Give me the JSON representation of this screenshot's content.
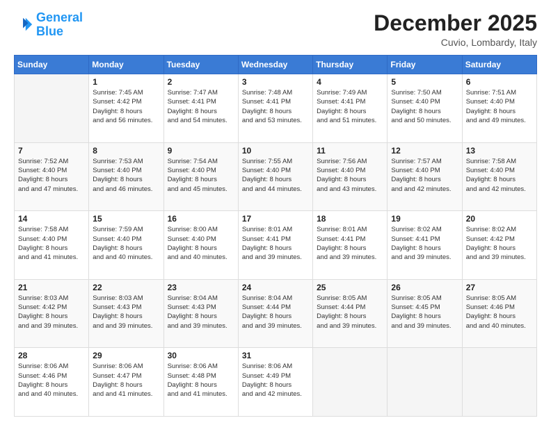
{
  "logo": {
    "line1": "General",
    "line2": "Blue"
  },
  "header": {
    "month": "December 2025",
    "location": "Cuvio, Lombardy, Italy"
  },
  "weekdays": [
    "Sunday",
    "Monday",
    "Tuesday",
    "Wednesday",
    "Thursday",
    "Friday",
    "Saturday"
  ],
  "weeks": [
    [
      {
        "day": "",
        "sunrise": "",
        "sunset": "",
        "daylight": ""
      },
      {
        "day": "1",
        "sunrise": "Sunrise: 7:45 AM",
        "sunset": "Sunset: 4:42 PM",
        "daylight": "Daylight: 8 hours and 56 minutes."
      },
      {
        "day": "2",
        "sunrise": "Sunrise: 7:47 AM",
        "sunset": "Sunset: 4:41 PM",
        "daylight": "Daylight: 8 hours and 54 minutes."
      },
      {
        "day": "3",
        "sunrise": "Sunrise: 7:48 AM",
        "sunset": "Sunset: 4:41 PM",
        "daylight": "Daylight: 8 hours and 53 minutes."
      },
      {
        "day": "4",
        "sunrise": "Sunrise: 7:49 AM",
        "sunset": "Sunset: 4:41 PM",
        "daylight": "Daylight: 8 hours and 51 minutes."
      },
      {
        "day": "5",
        "sunrise": "Sunrise: 7:50 AM",
        "sunset": "Sunset: 4:40 PM",
        "daylight": "Daylight: 8 hours and 50 minutes."
      },
      {
        "day": "6",
        "sunrise": "Sunrise: 7:51 AM",
        "sunset": "Sunset: 4:40 PM",
        "daylight": "Daylight: 8 hours and 49 minutes."
      }
    ],
    [
      {
        "day": "7",
        "sunrise": "Sunrise: 7:52 AM",
        "sunset": "Sunset: 4:40 PM",
        "daylight": "Daylight: 8 hours and 47 minutes."
      },
      {
        "day": "8",
        "sunrise": "Sunrise: 7:53 AM",
        "sunset": "Sunset: 4:40 PM",
        "daylight": "Daylight: 8 hours and 46 minutes."
      },
      {
        "day": "9",
        "sunrise": "Sunrise: 7:54 AM",
        "sunset": "Sunset: 4:40 PM",
        "daylight": "Daylight: 8 hours and 45 minutes."
      },
      {
        "day": "10",
        "sunrise": "Sunrise: 7:55 AM",
        "sunset": "Sunset: 4:40 PM",
        "daylight": "Daylight: 8 hours and 44 minutes."
      },
      {
        "day": "11",
        "sunrise": "Sunrise: 7:56 AM",
        "sunset": "Sunset: 4:40 PM",
        "daylight": "Daylight: 8 hours and 43 minutes."
      },
      {
        "day": "12",
        "sunrise": "Sunrise: 7:57 AM",
        "sunset": "Sunset: 4:40 PM",
        "daylight": "Daylight: 8 hours and 42 minutes."
      },
      {
        "day": "13",
        "sunrise": "Sunrise: 7:58 AM",
        "sunset": "Sunset: 4:40 PM",
        "daylight": "Daylight: 8 hours and 42 minutes."
      }
    ],
    [
      {
        "day": "14",
        "sunrise": "Sunrise: 7:58 AM",
        "sunset": "Sunset: 4:40 PM",
        "daylight": "Daylight: 8 hours and 41 minutes."
      },
      {
        "day": "15",
        "sunrise": "Sunrise: 7:59 AM",
        "sunset": "Sunset: 4:40 PM",
        "daylight": "Daylight: 8 hours and 40 minutes."
      },
      {
        "day": "16",
        "sunrise": "Sunrise: 8:00 AM",
        "sunset": "Sunset: 4:40 PM",
        "daylight": "Daylight: 8 hours and 40 minutes."
      },
      {
        "day": "17",
        "sunrise": "Sunrise: 8:01 AM",
        "sunset": "Sunset: 4:41 PM",
        "daylight": "Daylight: 8 hours and 39 minutes."
      },
      {
        "day": "18",
        "sunrise": "Sunrise: 8:01 AM",
        "sunset": "Sunset: 4:41 PM",
        "daylight": "Daylight: 8 hours and 39 minutes."
      },
      {
        "day": "19",
        "sunrise": "Sunrise: 8:02 AM",
        "sunset": "Sunset: 4:41 PM",
        "daylight": "Daylight: 8 hours and 39 minutes."
      },
      {
        "day": "20",
        "sunrise": "Sunrise: 8:02 AM",
        "sunset": "Sunset: 4:42 PM",
        "daylight": "Daylight: 8 hours and 39 minutes."
      }
    ],
    [
      {
        "day": "21",
        "sunrise": "Sunrise: 8:03 AM",
        "sunset": "Sunset: 4:42 PM",
        "daylight": "Daylight: 8 hours and 39 minutes."
      },
      {
        "day": "22",
        "sunrise": "Sunrise: 8:03 AM",
        "sunset": "Sunset: 4:43 PM",
        "daylight": "Daylight: 8 hours and 39 minutes."
      },
      {
        "day": "23",
        "sunrise": "Sunrise: 8:04 AM",
        "sunset": "Sunset: 4:43 PM",
        "daylight": "Daylight: 8 hours and 39 minutes."
      },
      {
        "day": "24",
        "sunrise": "Sunrise: 8:04 AM",
        "sunset": "Sunset: 4:44 PM",
        "daylight": "Daylight: 8 hours and 39 minutes."
      },
      {
        "day": "25",
        "sunrise": "Sunrise: 8:05 AM",
        "sunset": "Sunset: 4:44 PM",
        "daylight": "Daylight: 8 hours and 39 minutes."
      },
      {
        "day": "26",
        "sunrise": "Sunrise: 8:05 AM",
        "sunset": "Sunset: 4:45 PM",
        "daylight": "Daylight: 8 hours and 39 minutes."
      },
      {
        "day": "27",
        "sunrise": "Sunrise: 8:05 AM",
        "sunset": "Sunset: 4:46 PM",
        "daylight": "Daylight: 8 hours and 40 minutes."
      }
    ],
    [
      {
        "day": "28",
        "sunrise": "Sunrise: 8:06 AM",
        "sunset": "Sunset: 4:46 PM",
        "daylight": "Daylight: 8 hours and 40 minutes."
      },
      {
        "day": "29",
        "sunrise": "Sunrise: 8:06 AM",
        "sunset": "Sunset: 4:47 PM",
        "daylight": "Daylight: 8 hours and 41 minutes."
      },
      {
        "day": "30",
        "sunrise": "Sunrise: 8:06 AM",
        "sunset": "Sunset: 4:48 PM",
        "daylight": "Daylight: 8 hours and 41 minutes."
      },
      {
        "day": "31",
        "sunrise": "Sunrise: 8:06 AM",
        "sunset": "Sunset: 4:49 PM",
        "daylight": "Daylight: 8 hours and 42 minutes."
      },
      {
        "day": "",
        "sunrise": "",
        "sunset": "",
        "daylight": ""
      },
      {
        "day": "",
        "sunrise": "",
        "sunset": "",
        "daylight": ""
      },
      {
        "day": "",
        "sunrise": "",
        "sunset": "",
        "daylight": ""
      }
    ]
  ]
}
